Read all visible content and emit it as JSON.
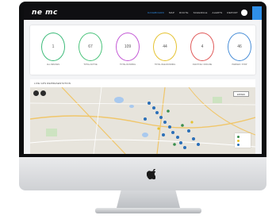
{
  "app": {
    "logo_text": "ne mc",
    "brand_color": "#2f8fe8"
  },
  "nav": {
    "items": [
      {
        "label": "DASHBOARD",
        "active": true
      },
      {
        "label": "MAP",
        "active": false
      },
      {
        "label": "ROUTE",
        "active": false
      },
      {
        "label": "SCHEDULE",
        "active": false
      },
      {
        "label": "ALERTS",
        "active": false
      },
      {
        "label": "REPORT",
        "active": false
      }
    ],
    "user_icon": "user-circle-icon"
  },
  "stats": [
    {
      "value": "1",
      "label": "ALL DEVICES",
      "color": "#3dbb7a"
    },
    {
      "value": "67",
      "label": "TOTAL ACTIVE",
      "color": "#4cc47c"
    },
    {
      "value": "109",
      "label": "TOTAL RUNNING",
      "color": "#c45ad6"
    },
    {
      "value": "44",
      "label": "TOTAL IDLE RUNNING",
      "color": "#e5c230"
    },
    {
      "value": "4",
      "label": "INACTIVE / OFFLINE",
      "color": "#e05a5a"
    },
    {
      "value": "46",
      "label": "PARKED / STOP",
      "color": "#4a8fd8"
    }
  ],
  "map": {
    "title": "LIVE GPS REPRESENTATION",
    "view_button": "EXPAND"
  }
}
